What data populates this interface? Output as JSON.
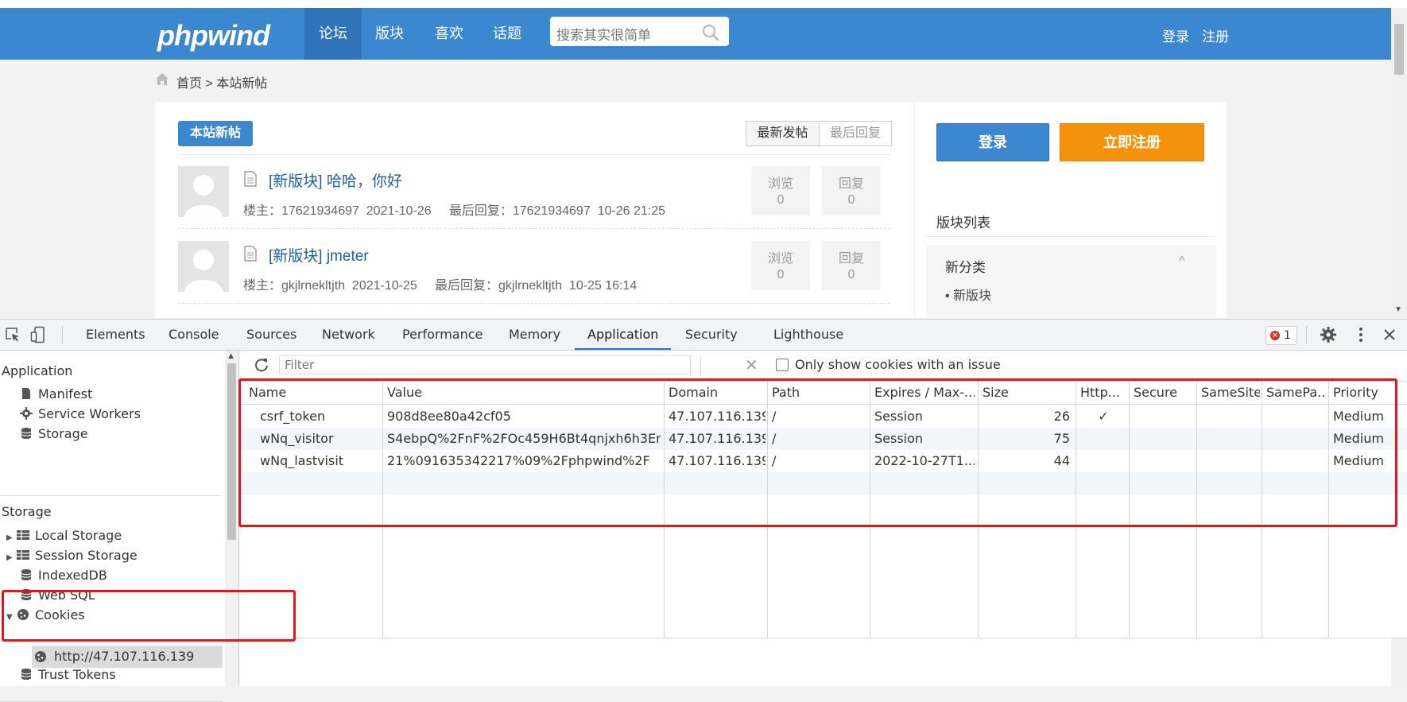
{
  "site": {
    "logo": "phpwind",
    "nav": [
      "论坛",
      "版块",
      "喜欢",
      "话题"
    ],
    "search_placeholder": "搜索其实很简单",
    "login": "登录",
    "register": "注册",
    "breadcrumb": "首页 > 本站新帖",
    "tag_new": "本站新帖",
    "tab_latest_post": "最新发帖",
    "tab_latest_reply": "最后回复",
    "threads": [
      {
        "title": "[新版块] 哈哈，你好",
        "meta": "楼主：17621934697  2021-10-26     最后回复：17621934697  10-26 21:25",
        "views_label": "浏览",
        "views": "0",
        "replies_label": "回复",
        "replies": "0"
      },
      {
        "title": "[新版块] jmeter",
        "meta": "楼主：gkjlrnekltjth  2021-10-25     最后回复：gkjlrnekltjth  10-25 16:14",
        "views_label": "浏览",
        "views": "0",
        "replies_label": "回复",
        "replies": "0"
      }
    ],
    "side_login": "登录",
    "side_register": "立即注册",
    "board_list_title": "版块列表",
    "board_category": "新分类",
    "board_category_arrow": "^",
    "board_item": "• 新版块"
  },
  "devtools": {
    "tabs": [
      "Elements",
      "Console",
      "Sources",
      "Network",
      "Performance",
      "Memory",
      "Application",
      "Security",
      "Lighthouse"
    ],
    "active_tab": "Application",
    "error_count": "1",
    "sidebar": {
      "application_header": "Application",
      "application_items": [
        "Manifest",
        "Service Workers",
        "Storage"
      ],
      "storage_header": "Storage",
      "storage_items": [
        "Local Storage",
        "Session Storage",
        "IndexedDB",
        "Web SQL",
        "Cookies"
      ],
      "cookie_host": "http://47.107.116.139",
      "trust_tokens": "Trust Tokens"
    },
    "filter_placeholder": "Filter",
    "only_issue_label": "Only show cookies with an issue",
    "columns": [
      "Name",
      "Value",
      "Domain",
      "Path",
      "Expires / Max-...",
      "Size",
      "Http...",
      "Secure",
      "SameSite",
      "SamePa...",
      "Priority"
    ],
    "cookies": [
      {
        "name": "csrf_token",
        "value": "908d8ee80a42cf05",
        "domain": "47.107.116.139",
        "path": "/",
        "expires": "Session",
        "size": "26",
        "http": "✓",
        "secure": "",
        "samesite": "",
        "sameparty": "",
        "priority": "Medium"
      },
      {
        "name": "wNq_visitor",
        "value": "S4ebpQ%2FnF%2FOc459H6Bt4qnjxh6h3EnF...",
        "domain": "47.107.116.139",
        "path": "/",
        "expires": "Session",
        "size": "75",
        "http": "",
        "secure": "",
        "samesite": "",
        "sameparty": "",
        "priority": "Medium"
      },
      {
        "name": "wNq_lastvisit",
        "value": "21%091635342217%09%2Fphpwind%2F",
        "domain": "47.107.116.139",
        "path": "/",
        "expires": "2022-10-27T1...",
        "size": "44",
        "http": "",
        "secure": "",
        "samesite": "",
        "sameparty": "",
        "priority": "Medium"
      }
    ]
  },
  "colors": {
    "nav_blue": "#3b87d0",
    "register_orange": "#f5920b",
    "highlight_red": "#e8141b",
    "devtools_active": "#1a73e8"
  }
}
